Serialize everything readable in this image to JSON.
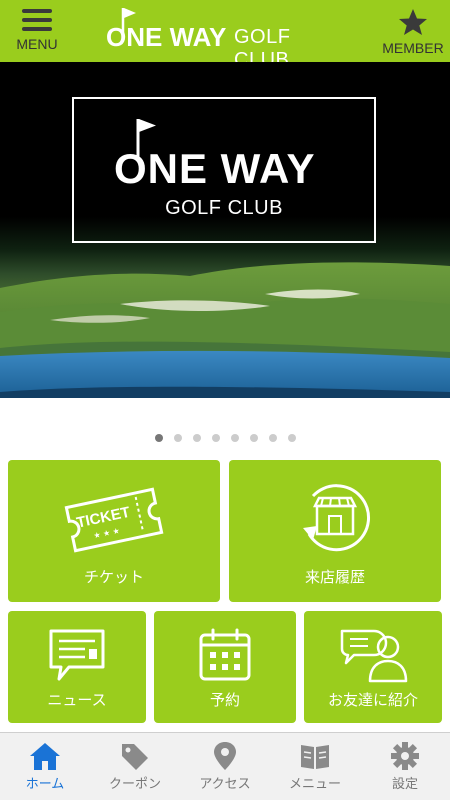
{
  "header": {
    "menu_label": "MENU",
    "member_label": "MEMBER",
    "logo_main": "ONE WAY",
    "logo_sub": "GOLF CLUB"
  },
  "hero": {
    "logo_main": "ONE WAY",
    "logo_sub": "GOLF CLUB",
    "slide_count": 8,
    "active_slide": 1
  },
  "tiles": [
    {
      "label": "チケット",
      "icon": "ticket-icon",
      "icon_text": "TICKET",
      "icon_stars": "★ ★ ★"
    },
    {
      "label": "来店履歴",
      "icon": "store-history-icon"
    },
    {
      "label": "ニュース",
      "icon": "news-icon"
    },
    {
      "label": "予約",
      "icon": "calendar-icon"
    },
    {
      "label": "お友達に紹介",
      "icon": "friend-referral-icon"
    }
  ],
  "bottom_nav": [
    {
      "label": "ホーム",
      "icon": "home-icon",
      "active": true
    },
    {
      "label": "クーポン",
      "icon": "coupon-tag-icon",
      "active": false
    },
    {
      "label": "アクセス",
      "icon": "map-pin-icon",
      "active": false
    },
    {
      "label": "メニュー",
      "icon": "book-icon",
      "active": false
    },
    {
      "label": "設定",
      "icon": "gear-icon",
      "active": false
    }
  ],
  "colors": {
    "brand_green": "#9acd1d",
    "active_blue": "#1a73d6",
    "inactive_gray": "#777777"
  }
}
